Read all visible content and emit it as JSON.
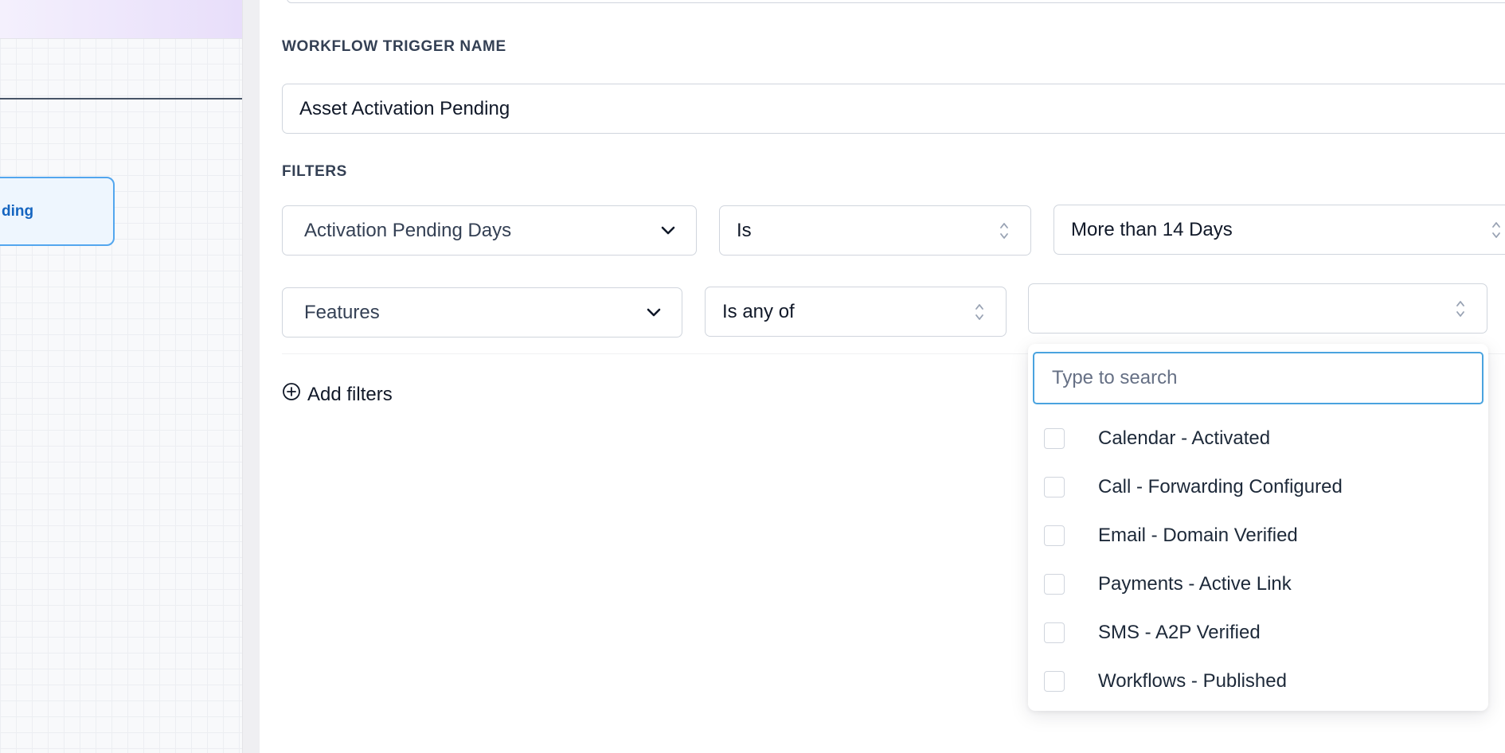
{
  "trigger_name_section": {
    "label": "WORKFLOW TRIGGER NAME",
    "value": "Asset Activation Pending"
  },
  "canvas": {
    "node_label": "ding"
  },
  "filters_section": {
    "label": "FILTERS",
    "rows": [
      {
        "field": "Activation Pending Days",
        "operator": "Is",
        "value": "More than 14 Days"
      },
      {
        "field": "Features",
        "operator": "Is any of",
        "value": ""
      }
    ],
    "add_label": "Add filters"
  },
  "dropdown": {
    "search_placeholder": "Type to search",
    "options": [
      "Calendar - Activated",
      "Call - Forwarding Configured",
      "Email - Domain Verified",
      "Payments - Active Link",
      "SMS - A2P Verified",
      "Workflows - Published"
    ]
  },
  "colors": {
    "accent_blue": "#4aa3df",
    "node_border": "#53a6ee",
    "node_text": "#1565c0",
    "label_text": "#344054"
  }
}
